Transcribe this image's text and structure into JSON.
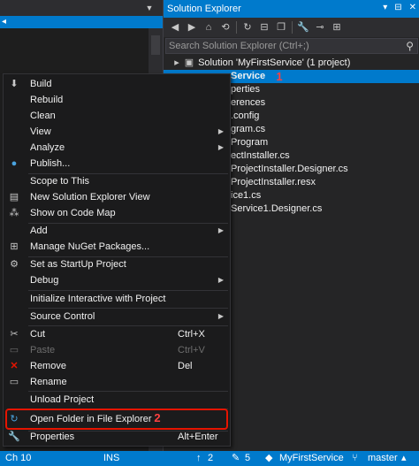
{
  "editor": {
    "dropdown_icon": "chevron-down-icon",
    "pin_icon": "arrow-left-icon"
  },
  "solution_explorer": {
    "title": "Solution Explorer",
    "title_buttons": [
      "▾",
      "✕",
      "⊟"
    ],
    "toolbar_icons": [
      "back-icon",
      "forward-icon",
      "home-icon",
      "history-icon",
      "refresh-icon",
      "collapse-icon",
      "copy-icon",
      "properties-icon",
      "pin-icon",
      "diagram-icon"
    ],
    "search_placeholder": "Search Solution Explorer (Ctrl+;)",
    "tree": [
      {
        "label": "Solution 'MyFirstService' (1 project)",
        "icon": "solution-icon"
      },
      {
        "label": "Service",
        "icon": "project-icon",
        "selected": true
      },
      {
        "label": "perties",
        "icon": ""
      },
      {
        "label": "erences",
        "icon": ""
      },
      {
        "label": ".config",
        "icon": ""
      },
      {
        "label": "gram.cs",
        "icon": ""
      },
      {
        "label": "Program",
        "icon": ""
      },
      {
        "label": "ectInstaller.cs",
        "icon": ""
      },
      {
        "label": "ProjectInstaller.Designer.cs",
        "icon": ""
      },
      {
        "label": "ProjectInstaller.resx",
        "icon": ""
      },
      {
        "label": "ice1.cs",
        "icon": ""
      },
      {
        "label": "Service1.Designer.cs",
        "icon": ""
      }
    ],
    "badge_1": "1"
  },
  "context_menu": {
    "items": [
      {
        "label": "Build",
        "icon": "build-icon",
        "shortcut": ""
      },
      {
        "label": "Rebuild",
        "icon": "",
        "shortcut": ""
      },
      {
        "label": "Clean",
        "icon": "",
        "shortcut": ""
      },
      {
        "label": "View",
        "icon": "",
        "shortcut": "",
        "submenu": true
      },
      {
        "label": "Analyze",
        "icon": "",
        "shortcut": "",
        "submenu": true
      },
      {
        "label": "Publish...",
        "icon": "globe-icon",
        "shortcut": ""
      },
      {
        "label": "Scope to This",
        "icon": "",
        "shortcut": ""
      },
      {
        "label": "New Solution Explorer View",
        "icon": "new-window-icon",
        "shortcut": ""
      },
      {
        "label": "Show on Code Map",
        "icon": "code-map-icon",
        "shortcut": ""
      },
      {
        "label": "Add",
        "icon": "",
        "shortcut": "",
        "submenu": true
      },
      {
        "label": "Manage NuGet Packages...",
        "icon": "nuget-icon",
        "shortcut": ""
      },
      {
        "label": "Set as StartUp Project",
        "icon": "gear-icon",
        "shortcut": ""
      },
      {
        "label": "Debug",
        "icon": "",
        "shortcut": "",
        "submenu": true
      },
      {
        "label": "Initialize Interactive with Project",
        "icon": "",
        "shortcut": ""
      },
      {
        "label": "Source Control",
        "icon": "",
        "shortcut": "",
        "submenu": true
      },
      {
        "label": "Cut",
        "icon": "cut-icon",
        "shortcut": "Ctrl+X"
      },
      {
        "label": "Paste",
        "icon": "paste-icon",
        "shortcut": "Ctrl+V",
        "disabled": true
      },
      {
        "label": "Remove",
        "icon": "remove-icon",
        "shortcut": "Del"
      },
      {
        "label": "Rename",
        "icon": "rename-icon",
        "shortcut": ""
      },
      {
        "label": "Unload Project",
        "icon": "",
        "shortcut": ""
      },
      {
        "label": "Open Folder in File Explorer",
        "icon": "open-folder-icon",
        "shortcut": ""
      },
      {
        "label": "Properties",
        "icon": "wrench-icon",
        "shortcut": "Alt+Enter"
      }
    ],
    "badge_2": "2"
  },
  "status_bar": {
    "col": "Ch 10",
    "mode": "INS",
    "up_count": "2",
    "edit_count": "5",
    "project": "MyFirstService",
    "branch": "master"
  },
  "colors": {
    "accent": "#007acc",
    "highlight": "#e51400",
    "menu_bg": "#1b1b1c"
  }
}
